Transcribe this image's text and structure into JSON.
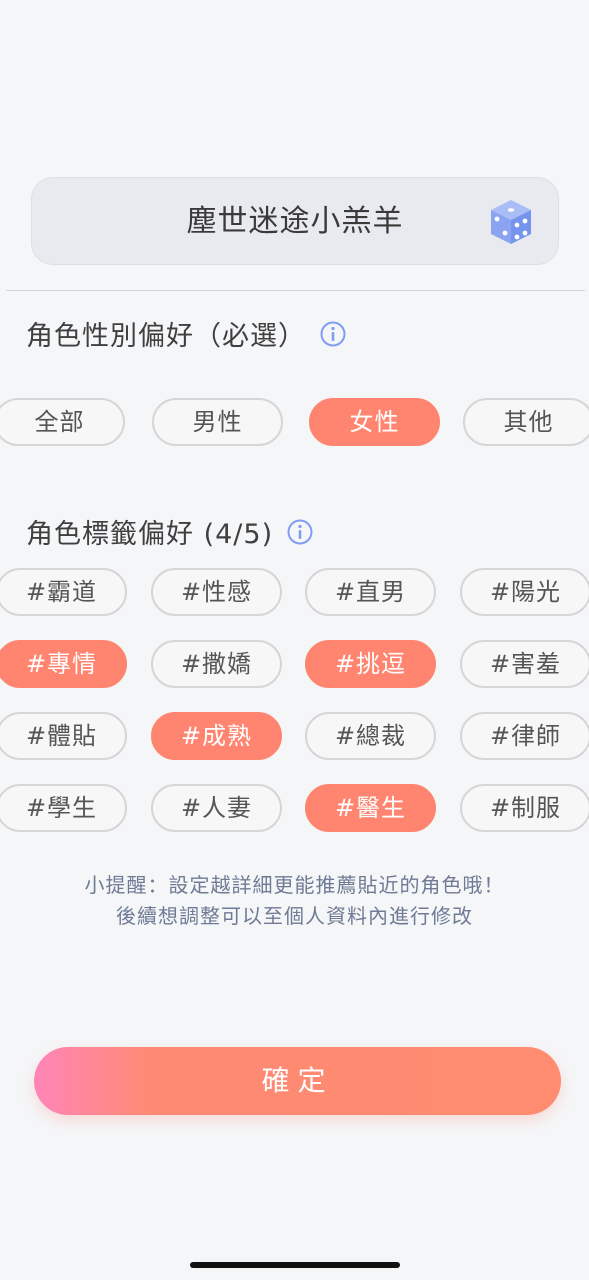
{
  "nickname": {
    "value": "塵世迷途小羔羊"
  },
  "gender_section": {
    "title": "角色性別偏好（必選）",
    "options": [
      {
        "label": "全部",
        "selected": false
      },
      {
        "label": "男性",
        "selected": false
      },
      {
        "label": "女性",
        "selected": true
      },
      {
        "label": "其他",
        "selected": false
      }
    ]
  },
  "tags_section": {
    "title": "角色標籤偏好 (4/5)",
    "tags": [
      {
        "label": "#霸道",
        "selected": false
      },
      {
        "label": "#性感",
        "selected": false
      },
      {
        "label": "#直男",
        "selected": false
      },
      {
        "label": "#陽光",
        "selected": false
      },
      {
        "label": "#專情",
        "selected": true
      },
      {
        "label": "#撒嬌",
        "selected": false
      },
      {
        "label": "#挑逗",
        "selected": true
      },
      {
        "label": "#害羞",
        "selected": false
      },
      {
        "label": "#體貼",
        "selected": false
      },
      {
        "label": "#成熟",
        "selected": true
      },
      {
        "label": "#總裁",
        "selected": false
      },
      {
        "label": "#律師",
        "selected": false
      },
      {
        "label": "#學生",
        "selected": false
      },
      {
        "label": "#人妻",
        "selected": false
      },
      {
        "label": "#醫生",
        "selected": true
      },
      {
        "label": "#制服",
        "selected": false
      }
    ]
  },
  "tip": {
    "line1": "小提醒：設定越詳細更能推薦貼近的角色哦！",
    "line2": "後續想調整可以至個人資料內進行修改"
  },
  "confirm_label": "確定",
  "colors": {
    "accent": "#ff8571",
    "gradient_start": "#ff85b8",
    "icon_blue": "#7f9df2",
    "background": "#f5f6f8"
  },
  "icons": {
    "dice": "dice-icon",
    "info": "info-icon"
  }
}
